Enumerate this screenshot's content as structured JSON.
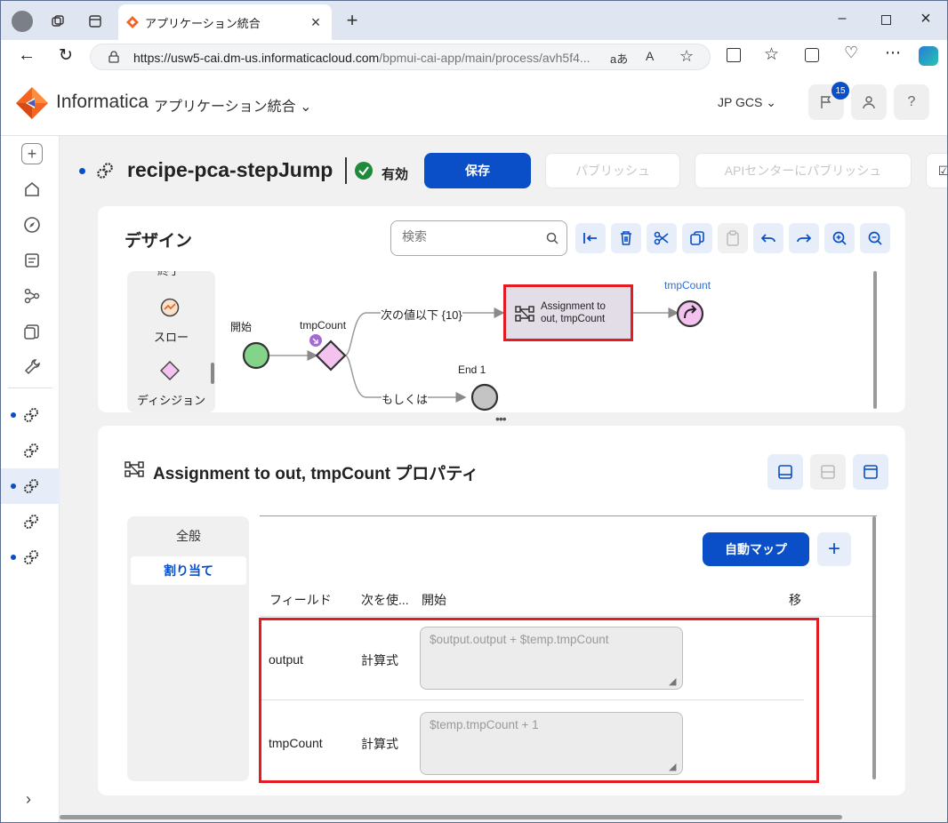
{
  "browser": {
    "tab_title": "アプリケーション統合",
    "url_host": "https://usw5-cai.dm-us.informaticacloud.com",
    "url_path": "/bpmui-cai-app/main/process/avh5f4..."
  },
  "header": {
    "brand": "Informatica",
    "app_name": "アプリケーション統合",
    "org": "JP GCS",
    "notif_count": "15",
    "help": "?"
  },
  "process": {
    "name": "recipe-pca-stepJump",
    "status": "有効",
    "save": "保存",
    "publish": "パブリッシュ",
    "publish_api": "APIセンターにパブリッシュ"
  },
  "design": {
    "title": "デザイン",
    "search_placeholder": "検索",
    "palette": {
      "top_cut": "終了",
      "flow": "スロー",
      "decision": "ディシジョン"
    },
    "nodes": {
      "start": "開始",
      "decision": "tmpCount",
      "assign_line1": "Assignment to",
      "assign_line2": "out, tmpCount",
      "jump": "tmpCount",
      "end": "End 1"
    },
    "edges": {
      "cond1": "次の値以下 {10}",
      "otherwise": "もしくは"
    }
  },
  "properties": {
    "title": "Assignment to out, tmpCount プロパティ",
    "tabs": [
      "全般",
      "割り当て"
    ],
    "automap": "自動マップ",
    "columns": {
      "field": "フィールド",
      "use": "次を使...",
      "start": "開始",
      "move": "移"
    },
    "rows": [
      {
        "field": "output",
        "type": "計算式",
        "value": "$output.output + $temp.tmpCount"
      },
      {
        "field": "tmpCount",
        "type": "計算式",
        "value": "$temp.tmpCount  + 1"
      }
    ]
  },
  "colors": {
    "primary": "#0a4fc8",
    "accent_red": "#e31b23",
    "start_green": "#84d38a",
    "decision_pink": "#f3c2ee"
  }
}
